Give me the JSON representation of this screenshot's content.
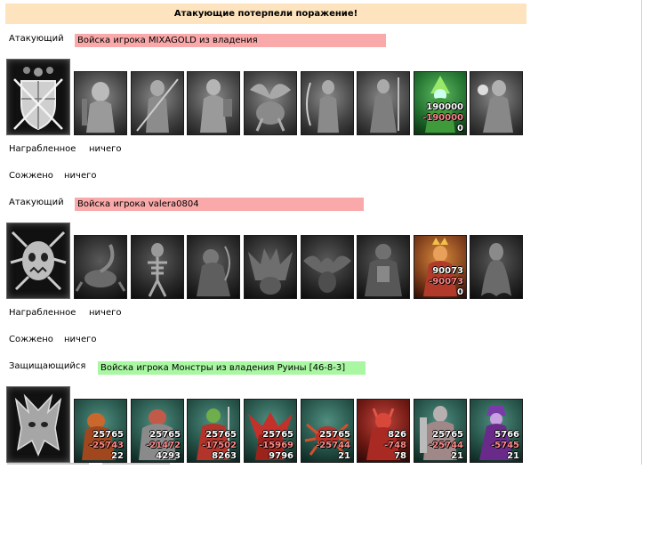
{
  "banner": "Атакующие потерпели поражение!",
  "sections": [
    {
      "role": "Атакующий",
      "army": "Войска игрока MIXAGOLD из владения",
      "army_color": "#f9a9a9",
      "crest": "shield-crossed-swords-icon",
      "loot_label": "Награбленное",
      "loot_value": "ничего",
      "burn_label": "Сожжено",
      "burn_value": "ничего",
      "units": [
        {
          "icon": "dwarf-unit-icon",
          "tint": "gray"
        },
        {
          "icon": "pikeman-unit-icon",
          "tint": "gray"
        },
        {
          "icon": "crusader-unit-icon",
          "tint": "gray"
        },
        {
          "icon": "griffin-unit-icon",
          "tint": "gray"
        },
        {
          "icon": "archer-unit-icon",
          "tint": "gray"
        },
        {
          "icon": "monk-unit-icon",
          "tint": "gray"
        },
        {
          "icon": "druid-unit-icon",
          "tint": "green",
          "count": "190000",
          "loss": "-190000",
          "remain": "0"
        },
        {
          "icon": "mage-unit-icon",
          "tint": "gray"
        }
      ]
    },
    {
      "role": "Атакующий",
      "army": "Войска игрока valera0804",
      "army_color": "#f9a9a9",
      "crest": "demon-skull-crest-icon",
      "loot_label": "Награбленное",
      "loot_value": "ничего",
      "burn_label": "Сожжено",
      "burn_value": "ничего",
      "units": [
        {
          "icon": "scorpion-unit-icon",
          "tint": "dark"
        },
        {
          "icon": "skeleton-unit-icon",
          "tint": "dark"
        },
        {
          "icon": "ghoul-unit-icon",
          "tint": "dark"
        },
        {
          "icon": "gargoyle-unit-icon",
          "tint": "dark"
        },
        {
          "icon": "bat-unit-icon",
          "tint": "dark"
        },
        {
          "icon": "ogre-unit-icon",
          "tint": "dark"
        },
        {
          "icon": "warlock-unit-icon",
          "tint": "dark"
        },
        {
          "icon": "lich-unit-icon",
          "tint": "orange",
          "count": "90073",
          "loss": "-90073",
          "remain": "0"
        },
        {
          "icon": "wraith-unit-icon",
          "tint": "dark"
        }
      ]
    },
    {
      "role": "Защищающийся",
      "army": "Войска игрока Монстры из владения Руины [46-8-3]",
      "army_color": "#a9f7a2",
      "crest": "monster-crest-icon",
      "units": [
        {
          "icon": "beast-unit-icon",
          "tint": "teal",
          "count": "25765",
          "loss": "-25743",
          "remain": "22"
        },
        {
          "icon": "golem-unit-icon",
          "tint": "teal",
          "count": "25765",
          "loss": "-21472",
          "remain": "4293"
        },
        {
          "icon": "orc-unit-icon",
          "tint": "teal",
          "count": "25765",
          "loss": "-17502",
          "remain": "8263"
        },
        {
          "icon": "demon-unit-icon",
          "tint": "teal",
          "count": "25765",
          "loss": "-15969",
          "remain": "9796"
        },
        {
          "icon": "spider-unit-icon",
          "tint": "teal",
          "count": "25765",
          "loss": "-25744",
          "remain": "21"
        },
        {
          "icon": "devil-unit-icon",
          "tint": "red",
          "count": "826",
          "loss": "-748",
          "remain": "78"
        },
        {
          "icon": "giant-unit-icon",
          "tint": "teal",
          "count": "25765",
          "loss": "-25744",
          "remain": "21"
        },
        {
          "icon": "sorceress-unit-icon",
          "tint": "teal",
          "count": "5766",
          "loss": "-5745",
          "remain": "21"
        }
      ]
    }
  ]
}
